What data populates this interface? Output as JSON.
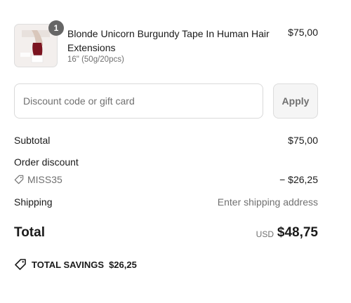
{
  "line_item": {
    "quantity": "1",
    "title": "Blonde Unicorn Burgundy Tape In Human Hair Extensions",
    "variant": "16\" (50g/20pcs)",
    "price": "$75,00",
    "image_icon": "product-thumbnail"
  },
  "discount": {
    "placeholder": "Discount code or gift card",
    "apply_label": "Apply"
  },
  "summary": {
    "subtotal_label": "Subtotal",
    "subtotal_value": "$75,00",
    "order_discount_label": "Order discount",
    "discount_code": "MISS35",
    "discount_value": "− $26,25",
    "shipping_label": "Shipping",
    "shipping_value": "Enter shipping address",
    "total_label": "Total",
    "currency": "USD",
    "total_value": "$48,75",
    "savings_label": "TOTAL SAVINGS",
    "savings_value": "$26,25"
  },
  "colors": {
    "text": "#1a1a1a",
    "muted": "#707070",
    "badge": "#666666",
    "border": "#d9d9d9"
  }
}
